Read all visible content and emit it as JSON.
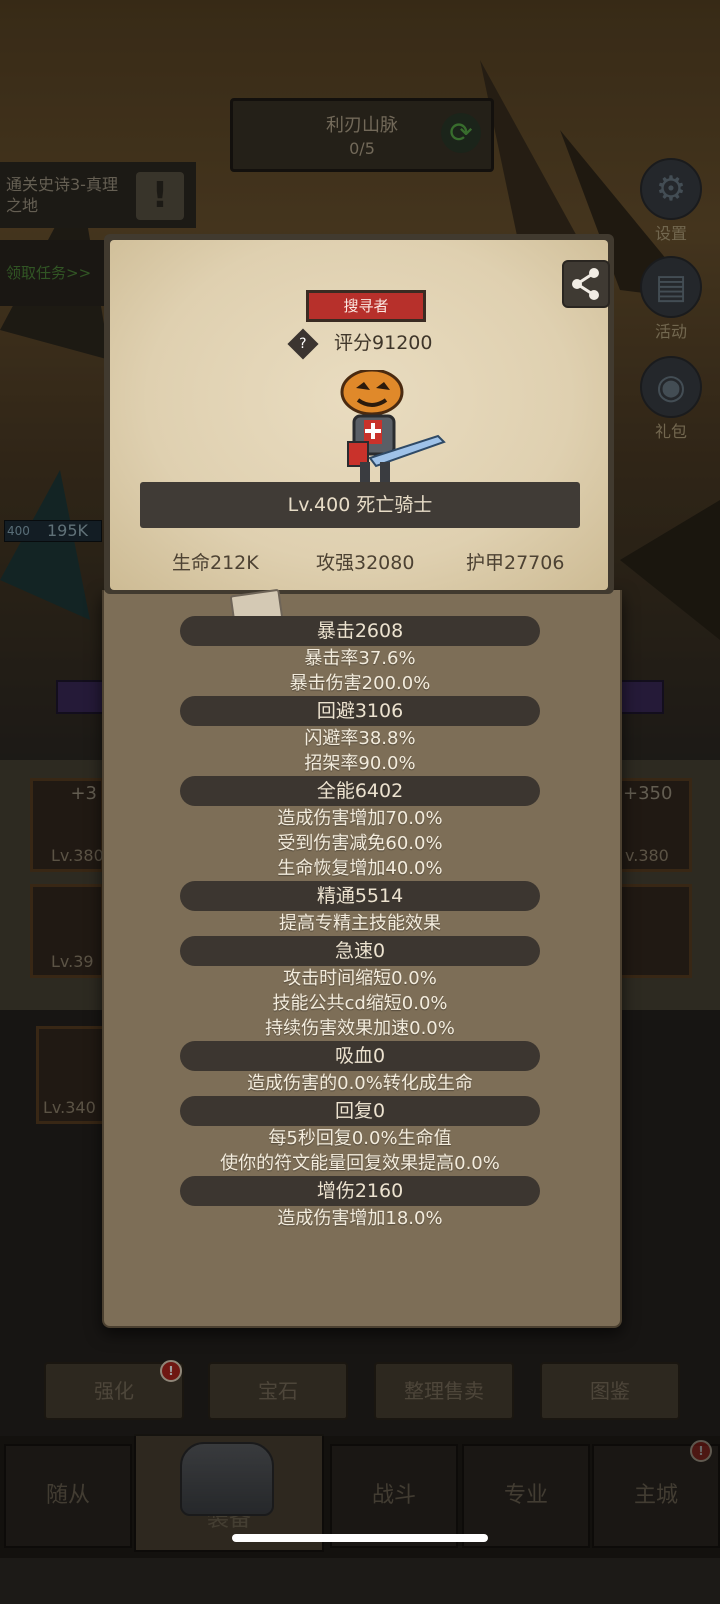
{
  "stage": {
    "name": "利刃山脉",
    "progress": "0/5"
  },
  "quest": {
    "text": "通关史诗3-真理之地",
    "claim": "领取任务>>"
  },
  "side_menu": [
    "设置",
    "活动",
    "礼包"
  ],
  "player_hp": {
    "level": "400",
    "value": "195K"
  },
  "equip_levels": {
    "slot1_plus": "+3",
    "slot1_lv": "Lv.380",
    "slot2_lv": "Lv.39",
    "slot3_lv": "Lv.340",
    "slot4_plus": "+350",
    "slot4_lv": "v.380"
  },
  "actions": [
    "强化",
    "宝石",
    "整理售卖",
    "图鉴"
  ],
  "alert_mark": "!",
  "nav": [
    "随从",
    "装备",
    "战斗",
    "专业",
    "主城"
  ],
  "modal": {
    "class_tag": "搜寻者",
    "rating_icon": "?",
    "rating": "评分91200",
    "level_name": "Lv.400 死亡骑士",
    "base": {
      "hp": "生命212K",
      "atk": "攻强32080",
      "armor": "护甲27706"
    },
    "stats": [
      {
        "head": "暴击2608",
        "lines": [
          "暴击率37.6%",
          "暴击伤害200.0%"
        ]
      },
      {
        "head": "回避3106",
        "lines": [
          "闪避率38.8%",
          "招架率90.0%"
        ]
      },
      {
        "head": "全能6402",
        "lines": [
          "造成伤害增加70.0%",
          "受到伤害减免60.0%",
          "生命恢复增加40.0%"
        ]
      },
      {
        "head": "精通5514",
        "lines": [
          "提高专精主技能效果"
        ]
      },
      {
        "head": "急速0",
        "lines": [
          "攻击时间缩短0.0%",
          "技能公共cd缩短0.0%",
          "持续伤害效果加速0.0%"
        ]
      },
      {
        "head": "吸血0",
        "lines": [
          "造成伤害的0.0%转化成生命"
        ]
      },
      {
        "head": "回复0",
        "lines": [
          "每5秒回复0.0%生命值",
          "使你的符文能量回复效果提高0.0%"
        ]
      },
      {
        "head": "增伤2160",
        "lines": [
          "造成伤害增加18.0%"
        ]
      }
    ]
  },
  "colors": {
    "accent_red": "#b7302b",
    "parchment": "#e2d4b6",
    "panel": "#7d6e57"
  }
}
